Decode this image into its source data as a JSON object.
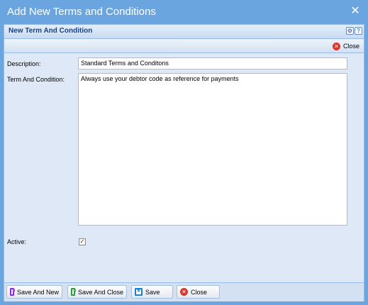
{
  "window": {
    "title": "Add New Terms and Conditions",
    "close_glyph": "✕"
  },
  "panel": {
    "title": "New Term And Condition",
    "icons": [
      "gear-icon",
      "help-icon"
    ]
  },
  "toolbar": {
    "close_label": "Close"
  },
  "form": {
    "description_label": "Description:",
    "description_value": "Standard Terms and Conditons",
    "term_label": "Term And Condition:",
    "term_value": "Always use your debtor code as reference for payments",
    "active_label": "Active:",
    "active_checked": true
  },
  "buttons": {
    "save_and_new": "Save And New",
    "save_and_close": "Save And Close",
    "save": "Save",
    "close": "Close"
  },
  "colors": {
    "window_frame": "#6aa5e0",
    "panel_bg": "#dfe8f6",
    "panel_title": "#15428b",
    "cancel_red": "#d9352b",
    "save_new_purple": "#8a2be2",
    "save_close_green": "#2e9b3a",
    "save_blue": "#1f7fd1"
  }
}
